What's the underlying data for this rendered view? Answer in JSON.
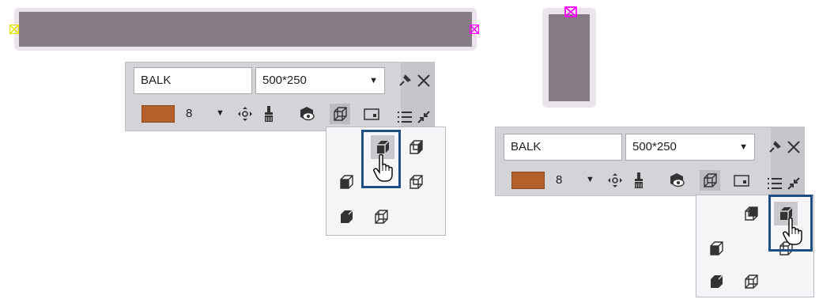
{
  "toolbar": {
    "name_value": "BALK",
    "profile_value": "500*250",
    "color_hex": "#b4602a",
    "color_number": "8",
    "dropdown_arrow": "▼",
    "pin_icon": "pin-icon",
    "close_icon": "close-icon"
  },
  "toolbar_icons": [
    "move-icon",
    "paint-brush-icon",
    "visibility-icon",
    "view-cube-icon",
    "section-icon",
    "list-icon",
    "collapse-icon"
  ],
  "view_options": [
    "view-back-right-icon",
    "view-back-left-icon",
    "view-front-left-icon",
    "view-front-right-icon",
    "view-bottom-solid-icon",
    "view-wireframe-icon"
  ],
  "grip_colors": {
    "yellow": "#ffff00",
    "magenta": "#ff00ff"
  }
}
